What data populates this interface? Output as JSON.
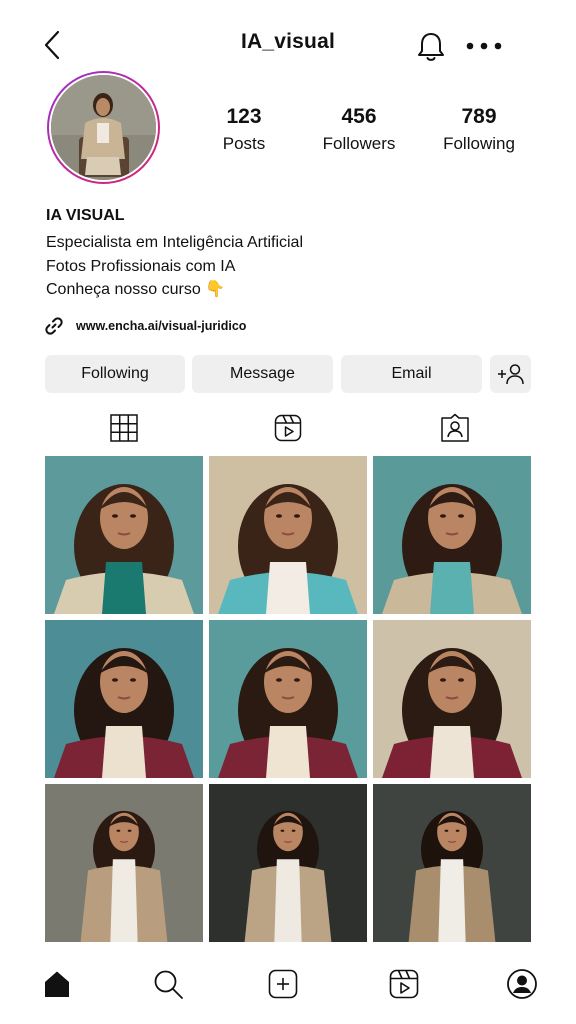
{
  "header": {
    "username": "IA_visual",
    "back_icon": "chevron-left-icon",
    "bell_icon": "bell-icon",
    "more_icon": "more-horizontal-icon"
  },
  "profile": {
    "avatar": "profile-photo-woman-in-beige-suit",
    "stats": {
      "posts": {
        "value": "123",
        "label": "Posts"
      },
      "followers": {
        "value": "456",
        "label": "Followers"
      },
      "following": {
        "value": "789",
        "label": "Following"
      }
    },
    "name": "IA VISUAL",
    "bio_lines": [
      "Especialista em Inteligência Artificial",
      "Fotos Profissionais com IA",
      "Conheça nosso curso 👇"
    ],
    "link": "www.encha.ai/visual-juridico"
  },
  "actions": {
    "following_label": "Following",
    "message_label": "Message",
    "email_label": "Email",
    "add_user_icon": "add-user-icon"
  },
  "tabs": [
    {
      "name": "grid",
      "icon": "grid-icon",
      "active": true
    },
    {
      "name": "reels",
      "icon": "reels-icon",
      "active": false
    },
    {
      "name": "tagged",
      "icon": "tagged-user-icon",
      "active": false
    }
  ],
  "grid_posts": [
    {
      "bg": "#5d9a9c",
      "shirt": "#1a7a70",
      "jacket": "#d8ccb0",
      "hair": "#3a2418"
    },
    {
      "bg": "#cfbfa2",
      "shirt": "#f2ece4",
      "jacket": "#59b8be",
      "hair": "#3a2418"
    },
    {
      "bg": "#5a9a98",
      "shirt": "#5bb0b0",
      "jacket": "#c9b89a",
      "hair": "#2e1c14"
    },
    {
      "bg": "#4d8e96",
      "shirt": "#ece0cf",
      "jacket": "#7a2436",
      "hair": "#241610"
    },
    {
      "bg": "#5a9c9c",
      "shirt": "#efe4d2",
      "jacket": "#7a2436",
      "hair": "#2a1a12"
    },
    {
      "bg": "#cdc2a9",
      "shirt": "#eee4d6",
      "jacket": "#7c2234",
      "hair": "#2b1b13"
    },
    {
      "bg": "#7b7a71",
      "shirt": "#efeae2",
      "jacket": "#b89e7e",
      "hair": "#2a1a12"
    },
    {
      "bg": "#2d302c",
      "shirt": "#eeeae2",
      "jacket": "#bba385",
      "hair": "#20140e"
    },
    {
      "bg": "#3f4440",
      "shirt": "#f0ece6",
      "jacket": "#a88e6c",
      "hair": "#1e120c"
    }
  ],
  "bottom_nav": [
    {
      "name": "home",
      "icon": "home-icon"
    },
    {
      "name": "search",
      "icon": "search-icon"
    },
    {
      "name": "create",
      "icon": "add-post-icon"
    },
    {
      "name": "reels",
      "icon": "reels-icon"
    },
    {
      "name": "profile",
      "icon": "profile-icon"
    }
  ],
  "colors": {
    "text": "#111111",
    "button_bg": "#efefef",
    "avatar_ring_start": "#9b30d0",
    "avatar_ring_end": "#d6276c"
  }
}
